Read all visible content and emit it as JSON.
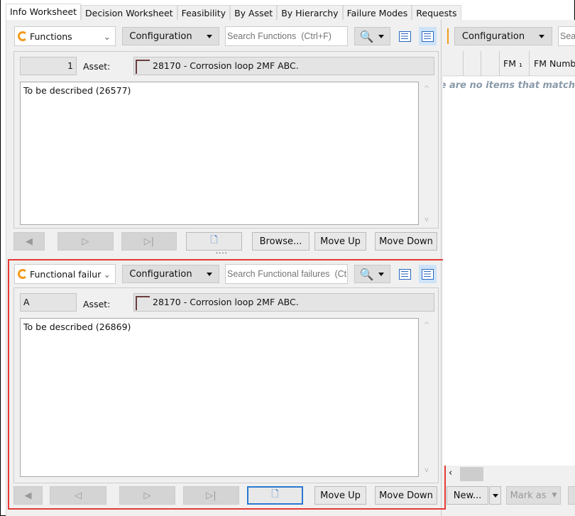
{
  "tabs": [
    "Info Worksheet",
    "Decision Worksheet",
    "Feasibility",
    "By Asset",
    "By Hierarchy",
    "Failure Modes",
    "Requests"
  ],
  "top": {
    "dropdown": "Functions",
    "config": "Configuration",
    "search_placeholder": "Search Functions  (Ctrl+F)",
    "number": "1",
    "asset_label": "Asset:",
    "asset_value": "28170 - Corrosion loop 2MF ABC.",
    "description": "To be described (26577)",
    "browse": "Browse...",
    "move_up": "Move Up",
    "move_down": "Move Down"
  },
  "bottom": {
    "dropdown": "Functional failur",
    "config": "Configuration",
    "search_placeholder": "Search Functional failures  (Ctrl+F)",
    "number": "A",
    "asset_label": "Asset:",
    "asset_value": "28170 - Corrosion loop 2MF ABC.",
    "description": "To be described (26869)",
    "move_up": "Move Up",
    "move_down": "Move Down"
  },
  "right": {
    "config": "Configuration",
    "search_placeholder": "Search",
    "col_fm": "FM ₁",
    "col_fm_number": "FM Number",
    "empty": "There are no items that match",
    "new": "New...",
    "mark_as": "Mark as"
  },
  "colors": {
    "highlight": "#e53935",
    "accent": "#2866c0"
  }
}
